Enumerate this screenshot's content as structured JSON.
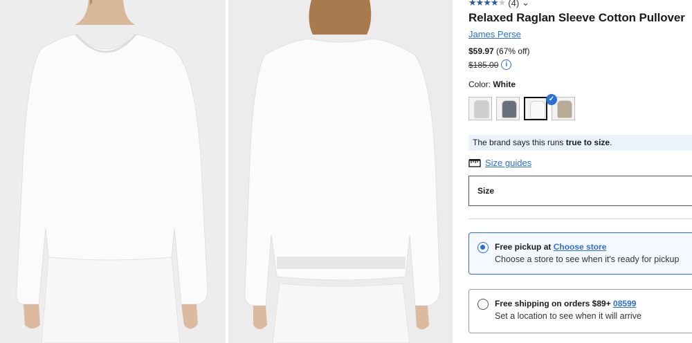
{
  "product": {
    "review_count": "(4)",
    "title": "Relaxed Raglan Sleeve Cotton Pullover",
    "brand": "James Perse",
    "sale_price": "$59.97",
    "discount": "(67% off)",
    "original_price": "$185.00",
    "rating": 3.5,
    "rating_max": 5
  },
  "color": {
    "label": "Color:",
    "selected": "White",
    "swatches": [
      {
        "name": "Light Gray",
        "hex": "#cfcfcf"
      },
      {
        "name": "Charcoal",
        "hex": "#6b717a"
      },
      {
        "name": "White",
        "hex": "#fafafa",
        "selected": true
      },
      {
        "name": "Taupe",
        "hex": "#b7ab97"
      }
    ]
  },
  "fit": {
    "prefix": "The brand says this runs ",
    "emphasis": "true to size",
    "suffix": "."
  },
  "size_guides": {
    "label": "Size guides"
  },
  "size": {
    "label": "Size"
  },
  "fulfillment": {
    "pickup": {
      "title": "Free pickup at ",
      "link": "Choose store",
      "detail": "Choose a store to see when it's ready for pickup"
    },
    "shipping": {
      "title": "Free shipping on orders $89+ ",
      "link": "08599",
      "detail": "Set a location to see when it will arrive"
    }
  },
  "icons": {
    "rating_chevron": "chevron-down-icon",
    "info": "info-icon",
    "ruler": "ruler-icon",
    "check": "check-icon"
  }
}
